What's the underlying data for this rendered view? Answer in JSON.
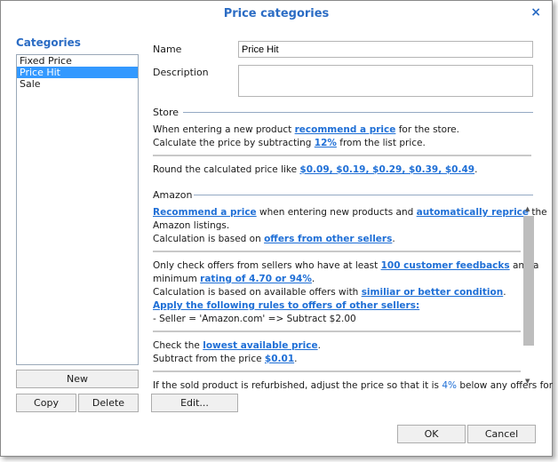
{
  "dialog": {
    "title": "Price categories",
    "close": "×"
  },
  "categories": {
    "heading": "Categories",
    "items": [
      "Fixed Price",
      "Price Hit",
      "Sale"
    ],
    "selected": "Price Hit",
    "new": "New",
    "copy": "Copy",
    "delete": "Delete"
  },
  "form": {
    "name_label": "Name",
    "name_value": "Price Hit",
    "description_label": "Description",
    "description_value": ""
  },
  "store": {
    "heading": "Store",
    "p1": [
      {
        "t": "When entering a new product "
      },
      {
        "t": "recommend a price",
        "l": 1
      },
      {
        "t": " for the store."
      }
    ],
    "p2": [
      {
        "t": "Calculate the price by subtracting "
      },
      {
        "t": "12%",
        "l": 1
      },
      {
        "t": " from the list price."
      }
    ],
    "p3": [
      {
        "t": "Round the calculated price like "
      },
      {
        "t": "$0.09, $0.19, $0.29, $0.39, $0.49",
        "l": 1
      },
      {
        "t": "."
      }
    ]
  },
  "amazon": {
    "heading": "Amazon",
    "lines": [
      [
        {
          "t": "Recommend a price",
          "l": 1
        },
        {
          "t": " when entering new products and "
        },
        {
          "t": "automatically reprice",
          "l": 1
        },
        {
          "t": " the"
        }
      ],
      [
        {
          "t": "Amazon listings."
        }
      ],
      [
        {
          "t": "Calculation is based on "
        },
        {
          "t": "offers from other sellers",
          "l": 1
        },
        {
          "t": "."
        }
      ],
      [
        {
          "t": "Only check offers from sellers who have at least "
        },
        {
          "t": "100 customer feedbacks",
          "l": 1
        },
        {
          "t": " and a"
        }
      ],
      [
        {
          "t": "minimum "
        },
        {
          "t": "rating of 4.70 or 94%",
          "l": 1
        },
        {
          "t": "."
        }
      ],
      [
        {
          "t": "Calculation is based on available offers with "
        },
        {
          "t": "similiar or better condition",
          "l": 1
        },
        {
          "t": "."
        }
      ],
      [
        {
          "t": "Apply the following rules to offers of other sellers:",
          "l": 1
        }
      ],
      [
        {
          "t": "- Seller = 'Amazon.com' => Subtract $2.00"
        }
      ],
      [
        {
          "t": "Check the "
        },
        {
          "t": "lowest available price",
          "l": 1
        },
        {
          "t": "."
        }
      ],
      [
        {
          "t": "Subtract from the price "
        },
        {
          "t": "$0.01",
          "l": 1
        },
        {
          "t": "."
        }
      ],
      [
        {
          "t": "If the sold product is refurbished, adjust the price so that it is "
        },
        {
          "t": "4%",
          "h": 1
        },
        {
          "t": " below any offers for"
        }
      ]
    ],
    "edit": "Edit..."
  },
  "footer": {
    "ok": "OK",
    "cancel": "Cancel"
  }
}
